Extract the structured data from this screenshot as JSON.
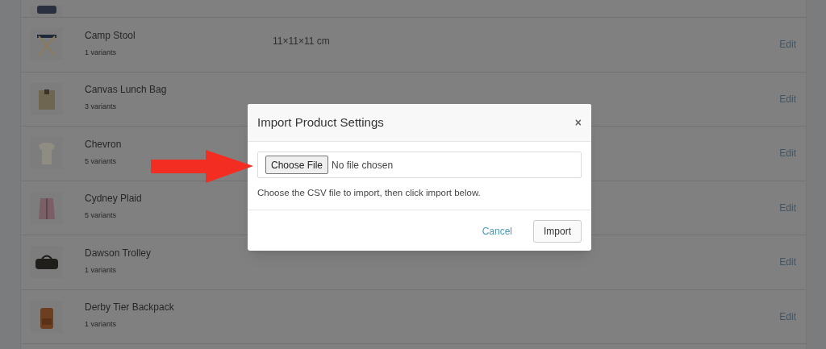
{
  "products": [
    {
      "name": "Camp Stool",
      "variants": "1 variants",
      "dimensions": "11×11×11 cm",
      "action": "Edit"
    },
    {
      "name": "Canvas Lunch Bag",
      "variants": "3 variants",
      "action": "Edit"
    },
    {
      "name": "Chevron",
      "variants": "5 variants",
      "action": "Edit"
    },
    {
      "name": "Cydney Plaid",
      "variants": "5 variants",
      "action": "Edit"
    },
    {
      "name": "Dawson Trolley",
      "variants": "1 variants",
      "action": "Edit"
    },
    {
      "name": "Derby Tier Backpack",
      "variants": "1 variants",
      "action": "Edit"
    }
  ],
  "dialog": {
    "title": "Import Product Settings",
    "close": "×",
    "file_button": "Choose File",
    "file_status": "No file chosen",
    "help": "Choose the CSV file to import, then click import below.",
    "buttons": [
      {
        "label": "Cancel",
        "kind": "link"
      },
      {
        "label": "Import",
        "kind": "button"
      }
    ]
  }
}
